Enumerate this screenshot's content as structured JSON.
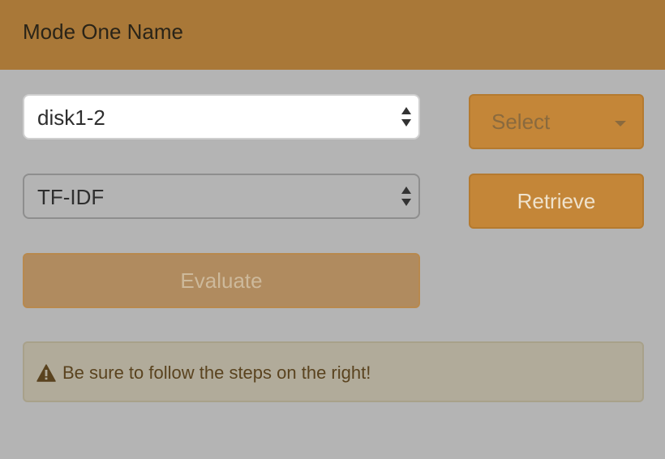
{
  "header": {
    "title": "Mode One Name"
  },
  "controls": {
    "dataset_select": {
      "value": "disk1-2"
    },
    "model_select": {
      "value": "TF-IDF"
    },
    "select_button_label": "Select",
    "retrieve_button_label": "Retrieve",
    "evaluate_button_label": "Evaluate"
  },
  "alert": {
    "icon": "warning-triangle-icon",
    "text": "Be sure to follow the steps on the right!"
  },
  "colors": {
    "header_bg": "#a97838",
    "page_bg": "#b4b4b4",
    "button_accent": "#c48638",
    "alert_text": "#5a431f"
  }
}
